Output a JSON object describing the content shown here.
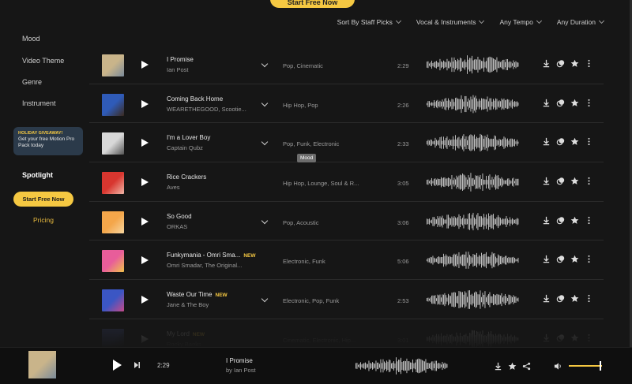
{
  "top_cta": {
    "label": "Start Free Now"
  },
  "sidebar": {
    "links": [
      {
        "label": "Mood"
      },
      {
        "label": "Video Theme"
      },
      {
        "label": "Genre"
      },
      {
        "label": "Instrument"
      }
    ],
    "promo": {
      "tag": "HOLIDAY GIVEAWAY!",
      "text": "Get your free Motion Pro Pack today"
    },
    "spotlight": "Spotlight",
    "cta": "Start Free Now",
    "pricing": "Pricing"
  },
  "filters": [
    {
      "label": "Sort By Staff Picks"
    },
    {
      "label": "Vocal & Instruments"
    },
    {
      "label": "Any Tempo"
    },
    {
      "label": "Any Duration"
    }
  ],
  "tooltip": "Mood",
  "tracks": [
    {
      "title": "I Promise",
      "new_badge": "",
      "artist": "Ian Post",
      "genres": "Pop,  Cinematic",
      "duration": "2:29",
      "expandable": true,
      "thumb_colors": [
        "#c9b48a",
        "#7a8a9a"
      ]
    },
    {
      "title": "Coming Back Home",
      "new_badge": "",
      "artist": "WEARETHEGOOD, Scootie...",
      "genres": "Hip Hop,  Pop",
      "duration": "2:26",
      "expandable": true,
      "thumb_colors": [
        "#2f5bb8",
        "#3b2a1e"
      ]
    },
    {
      "title": "I'm a Lover Boy",
      "new_badge": "",
      "artist": "Captain Qubz",
      "genres": "Pop,  Funk,  Electronic",
      "duration": "2:33",
      "expandable": true,
      "thumb_colors": [
        "#d8d8d8",
        "#555555"
      ]
    },
    {
      "title": "Rice Crackers",
      "new_badge": "",
      "artist": "Aves",
      "genres": "Hip Hop,  Lounge,  Soul & R...",
      "duration": "3:05",
      "expandable": false,
      "thumb_colors": [
        "#d8362f",
        "#f0b7a8"
      ]
    },
    {
      "title": "So Good",
      "new_badge": "",
      "artist": "ORKAS",
      "genres": "Pop,  Acoustic",
      "duration": "3:06",
      "expandable": true,
      "thumb_colors": [
        "#f4a64a",
        "#f7d6a0"
      ]
    },
    {
      "title": "Funkymania - Omri Sma...",
      "new_badge": "NEW",
      "artist": "Omri Smadar, The Original...",
      "genres": "Electronic,  Funk",
      "duration": "5:06",
      "expandable": false,
      "thumb_colors": [
        "#e85d9a",
        "#f0c24a"
      ]
    },
    {
      "title": "Waste Our Time",
      "new_badge": "NEW",
      "artist": "Jane & The Boy",
      "genres": "Electronic,  Pop,  Funk",
      "duration": "2:53",
      "expandable": true,
      "thumb_colors": [
        "#3b56c4",
        "#c64a8a"
      ]
    },
    {
      "title": "My Lord",
      "new_badge": "NEW",
      "artist": "Rocky Banks",
      "genres": "Cinematic,  Electronic,  Hip...",
      "duration": "3:01",
      "expandable": false,
      "thumb_colors": [
        "#4a5a9a",
        "#222222"
      ]
    }
  ],
  "player": {
    "time": "2:29",
    "title": "I Promise",
    "artist": "by Ian Post",
    "volume": 1.0,
    "thumb_colors": [
      "#c9b48a",
      "#7a8a9a"
    ]
  },
  "icons": {
    "download": "download-icon",
    "collection": "add-to-collection-icon",
    "favorite": "star-icon",
    "more": "more-vertical-icon",
    "share": "share-icon",
    "volume": "volume-icon",
    "next": "skip-next-icon"
  }
}
